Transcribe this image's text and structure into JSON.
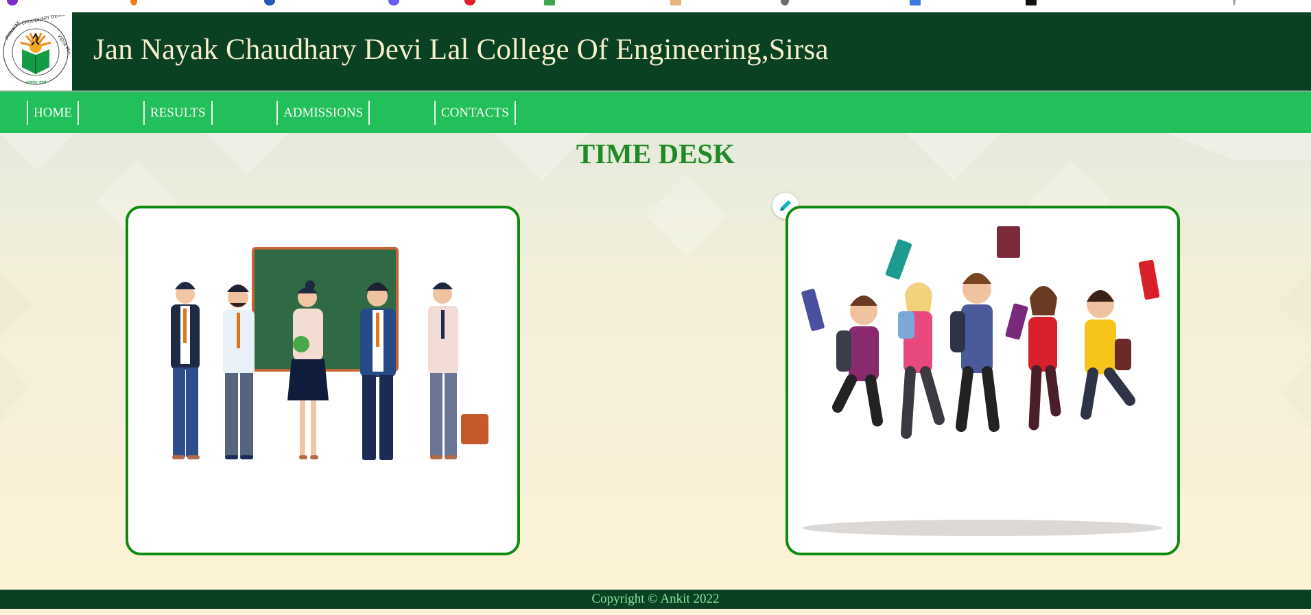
{
  "browser": {
    "bookmark_icons": [
      {
        "name": "bookmark-favicon-purple",
        "color": "#7b2fd0"
      },
      {
        "name": "bookmark-favicon-orange",
        "color": "#f07b1a"
      },
      {
        "name": "bookmark-favicon-blue",
        "color": "#1f5bb5"
      },
      {
        "name": "bookmark-favicon-indigo",
        "color": "#6a5cf0"
      },
      {
        "name": "bookmark-favicon-red",
        "color": "#e0202a"
      },
      {
        "name": "bookmark-favicon-green",
        "color": "#3aa84a"
      },
      {
        "name": "bookmark-favicon-tan",
        "color": "#e6b676"
      },
      {
        "name": "bookmark-favicon-gray",
        "color": "#6b6b6b"
      },
      {
        "name": "bookmark-favicon-blue-grid",
        "color": "#3b7be0"
      },
      {
        "name": "bookmark-favicon-black",
        "color": "#111111"
      }
    ]
  },
  "header": {
    "title": "Jan Nayak Chaudhary Devi Lal College Of Engineering,Sirsa",
    "logo": {
      "ring_text": "JANNAYAK CHOUDHARY DEVILAL VIDYA PEETH",
      "icon": "college-logo"
    }
  },
  "nav": {
    "items": [
      {
        "label": "HOME"
      },
      {
        "label": "RESULTS"
      },
      {
        "label": "ADMISSIONS"
      },
      {
        "label": "CONTACTS"
      }
    ]
  },
  "main": {
    "heading": "TIME DESK",
    "cards": [
      {
        "image": "teachers-illustration"
      },
      {
        "image": "students-jumping-illustration"
      }
    ],
    "edit_badge_icon": "edit-pen-icon"
  },
  "footer": {
    "text": "Copyright © Ankit 2022"
  },
  "colors": {
    "header_bg": "#0a4123",
    "nav_bg": "#22c05a",
    "title_text": "#f6efcb",
    "heading": "#1f8a25",
    "card_border": "#0f8a0f",
    "footer_text": "#8fe3a3"
  }
}
